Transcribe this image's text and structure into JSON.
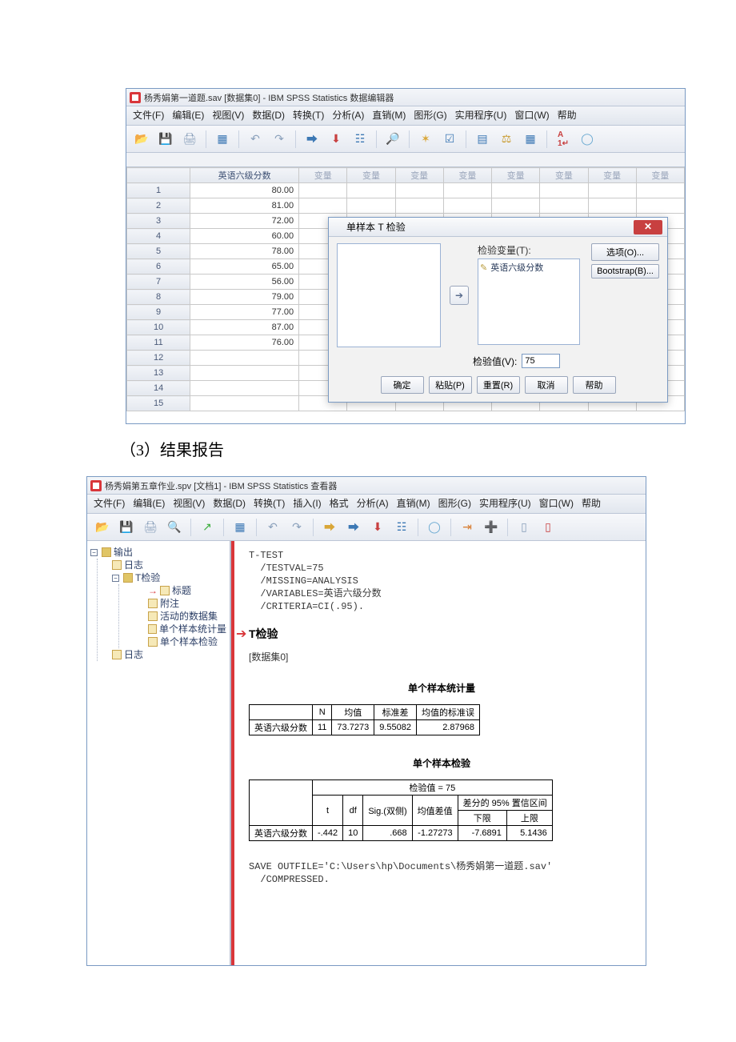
{
  "data_editor": {
    "title": "杨秀娟第一道题.sav [数据集0] - IBM SPSS Statistics 数据编辑器",
    "menu": [
      "文件(F)",
      "编辑(E)",
      "视图(V)",
      "数据(D)",
      "转换(T)",
      "分析(A)",
      "直销(M)",
      "图形(G)",
      "实用程序(U)",
      "窗口(W)",
      "帮助"
    ],
    "column_header": "英语六级分数",
    "var_label": "变量",
    "rows": [
      "80.00",
      "81.00",
      "72.00",
      "60.00",
      "78.00",
      "65.00",
      "56.00",
      "79.00",
      "77.00",
      "87.00",
      "76.00",
      "",
      "",
      "",
      ""
    ],
    "toolbar_icons": [
      "folder-open",
      "save",
      "print",
      "data-grid",
      "undo",
      "redo",
      "goto-case",
      "insert-case",
      "insert-var",
      "find",
      "select",
      "weight",
      "value-labels",
      "scale",
      "variables",
      "abc",
      "globe"
    ]
  },
  "dialog": {
    "title": "单样本 T 检验",
    "test_var_label": "检验变量(T):",
    "test_var_item": "英语六级分数",
    "test_value_label": "检验值(V):",
    "test_value": "75",
    "side_buttons": [
      "选项(O)...",
      "Bootstrap(B)..."
    ],
    "bottom_buttons": [
      "确定",
      "粘贴(P)",
      "重置(R)",
      "取消",
      "帮助"
    ]
  },
  "heading3": "（3）结果报告",
  "viewer": {
    "title": "杨秀娟第五章作业.spv [文档1] - IBM SPSS Statistics 查看器",
    "menu": [
      "文件(F)",
      "编辑(E)",
      "视图(V)",
      "数据(D)",
      "转换(T)",
      "插入(I)",
      "格式",
      "分析(A)",
      "直销(M)",
      "图形(G)",
      "实用程序(U)",
      "窗口(W)",
      "帮助"
    ],
    "outline": {
      "root": "输出",
      "log1": "日志",
      "ttest": "T检验",
      "title_node": "标题",
      "notes": "附注",
      "active_dataset": "活动的数据集",
      "stats_node": "单个样本统计量",
      "test_node": "单个样本检验",
      "log2": "日志"
    },
    "syntax_cmd": "T-TEST\n  /TESTVAL=75\n  /MISSING=ANALYSIS\n  /VARIABLES=英语六级分数\n  /CRITERIA=CI(.95).",
    "section_title": "T检验",
    "dataset_label": "[数据集0]",
    "table1": {
      "caption": "单个样本统计量",
      "headers": [
        "",
        "N",
        "均值",
        "标准差",
        "均值的标准误"
      ],
      "row_label": "英语六级分数",
      "cells": [
        "11",
        "73.7273",
        "9.55082",
        "2.87968"
      ]
    },
    "table2": {
      "caption": "单个样本检验",
      "superhead": "检验值 = 75",
      "ci_head": "差分的 95% 置信区间",
      "headers": [
        "",
        "t",
        "df",
        "Sig.(双侧)",
        "均值差值",
        "下限",
        "上限"
      ],
      "row_label": "英语六级分数",
      "cells": [
        "-.442",
        "10",
        ".668",
        "-1.27273",
        "-7.6891",
        "5.1436"
      ]
    },
    "save_syntax": "SAVE OUTFILE='C:\\Users\\hp\\Documents\\杨秀娟第一道题.sav'\n  /COMPRESSED."
  },
  "chart_data": {
    "type": "table",
    "tables": [
      {
        "name": "单个样本统计量",
        "row": "英语六级分数",
        "N": 11,
        "mean": 73.7273,
        "std_dev": 9.55082,
        "se_mean": 2.87968
      },
      {
        "name": "单个样本检验",
        "test_value": 75,
        "row": "英语六级分数",
        "t": -0.442,
        "df": 10,
        "sig_two_tailed": 0.668,
        "mean_diff": -1.27273,
        "ci95_lower": -7.6891,
        "ci95_upper": 5.1436
      }
    ]
  }
}
